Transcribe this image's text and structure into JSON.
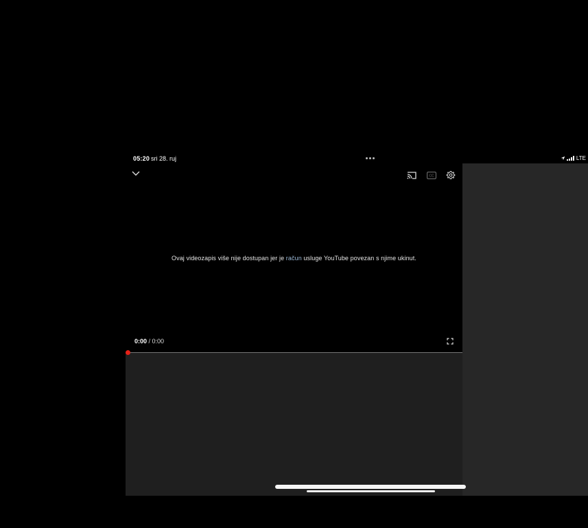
{
  "status_bar": {
    "time": "05:20",
    "date": "sri 28. ruj",
    "network": "LTE",
    "icons": [
      "location-arrow-icon",
      "signal-icon"
    ]
  },
  "player": {
    "top_icons": [
      "chevron-down-icon",
      "cast-icon",
      "cc-icon",
      "gear-icon"
    ],
    "message_before": "Ovaj videozapis više nije dostupan jer je ",
    "message_link": "račun",
    "message_after": " usluge YouTube povezan s njime ukinut.",
    "time_current": "0:00",
    "time_separator": " / ",
    "time_total": "0:00",
    "progress": 0,
    "fullscreen_icon": "fullscreen-icon"
  },
  "colors": {
    "background": "#000000",
    "panel": "#272727",
    "below_video": "#1f1f1f",
    "accent": "#e62117",
    "link": "#9ab8d6"
  }
}
